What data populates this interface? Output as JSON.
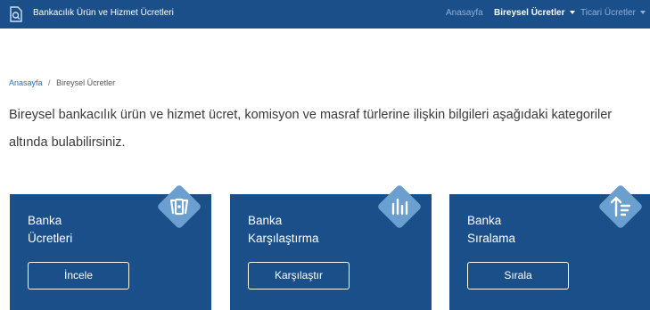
{
  "navbar": {
    "title": "Bankacılık Ürün ve Hizmet Ücretleri",
    "links": [
      {
        "label": "Anasayfa"
      },
      {
        "label": "Bireysel Ücretler"
      },
      {
        "label": "Ticari Ücretler"
      }
    ],
    "logo_icon": "document-search-icon"
  },
  "breadcrumb": {
    "home": "Anasayfa",
    "separator": "/",
    "current": "Bireysel Ücretler"
  },
  "intro": "Bireysel bankacılık ürün ve hizmet ücret, komisyon ve masraf türlerine ilişkin bilgileri aşağıdaki kategoriler altında bulabilirsiniz.",
  "cards": [
    {
      "title_line1": "Banka",
      "title_line2": "Ücretleri",
      "button": "İncele",
      "icon": "banknotes-icon"
    },
    {
      "title_line1": "Banka",
      "title_line2": "Karşılaştırma",
      "button": "Karşılaştır",
      "icon": "bar-chart-icon"
    },
    {
      "title_line1": "Banka",
      "title_line2": "Sıralama",
      "button": "Sırala",
      "icon": "sort-icon"
    }
  ],
  "colors": {
    "primary": "#1a4f8a",
    "icon_diamond": "#6b9fd0",
    "link": "#1a73c9",
    "nav_muted": "#8fb0d8"
  }
}
